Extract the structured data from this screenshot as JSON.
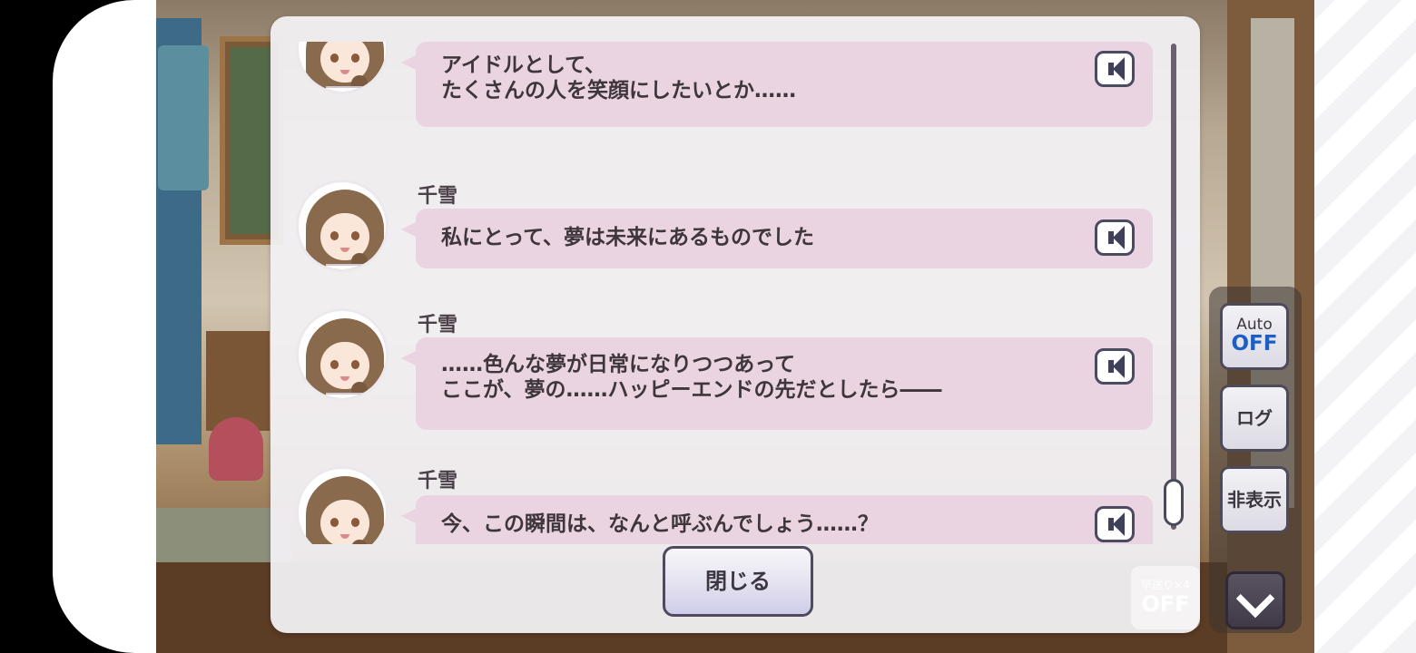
{
  "log": {
    "entries": [
      {
        "speaker": "",
        "lines": [
          "アイドルとして、",
          "たくさんの人を笑顔にしたいとか……"
        ]
      },
      {
        "speaker": "千雪",
        "lines": [
          "私にとって、夢は未来にあるものでした"
        ]
      },
      {
        "speaker": "千雪",
        "lines": [
          "……色んな夢が日常になりつつあって",
          "ここが、夢の……ハッピーエンドの先だとしたら――"
        ]
      },
      {
        "speaker": "千雪",
        "lines": [
          "今、この瞬間は、なんと呼ぶんでしょう……？"
        ]
      }
    ],
    "close_label": "閉じる"
  },
  "controls": {
    "auto_label": "Auto",
    "auto_state": "OFF",
    "log_label": "ログ",
    "hide_label": "非表示",
    "fast_forward_label": "早送り×4",
    "fast_forward_state": "OFF"
  },
  "icons": {
    "voice": "speaker-icon",
    "menu": "chevron-down-icon"
  },
  "colors": {
    "bubble": "#ead4e1",
    "dialog_bg": "#f2f0f3",
    "auto_state": "#1d5fc4",
    "menu_button": "#403a48"
  }
}
